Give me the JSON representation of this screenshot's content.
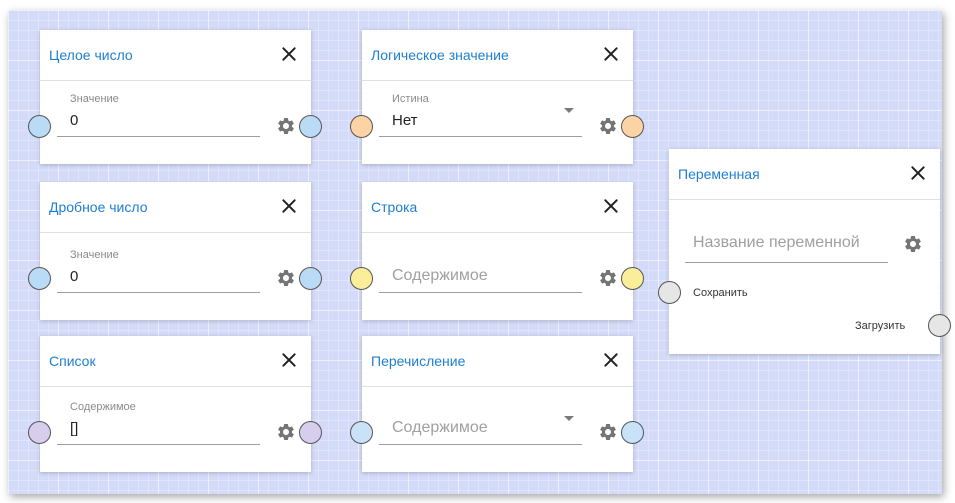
{
  "nodes": {
    "integer": {
      "title": "Целое число",
      "label": "Значение",
      "value": "0",
      "port_color": "#b9dbf5"
    },
    "boolean": {
      "title": "Логическое значение",
      "label": "Истина",
      "value": "Нет",
      "port_color": "#fcd3a4"
    },
    "float": {
      "title": "Дробное число",
      "label": "Значение",
      "value": "0",
      "port_color": "#b9dbf5"
    },
    "string": {
      "title": "Строка",
      "placeholder": "Содержимое",
      "port_color": "#fbee9a"
    },
    "list": {
      "title": "Список",
      "label": "Содержимое",
      "value": "[]",
      "port_color": "#d7cdec"
    },
    "enum": {
      "title": "Перечисление",
      "placeholder": "Содержимое",
      "port_color": "#c9e2f8"
    },
    "variable": {
      "title": "Переменная",
      "placeholder": "Название переменной",
      "save_label": "Сохранить",
      "load_label": "Загрузить",
      "port_color": "#e6e6e6"
    }
  },
  "icons": {
    "close": "close-icon",
    "settings": "gear-icon"
  },
  "colors": {
    "title_accent": "#1e7fd2",
    "canvas_bg": "#d4dbf8"
  }
}
